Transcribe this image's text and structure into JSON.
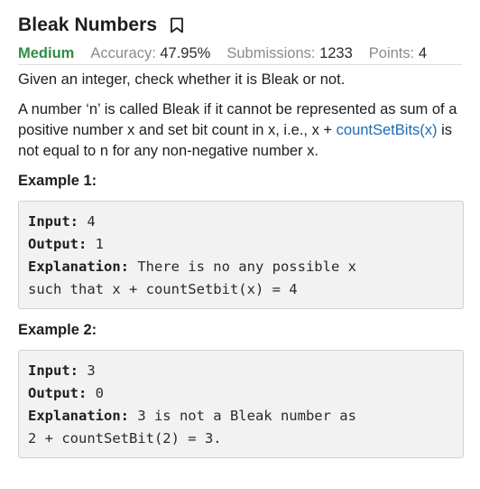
{
  "problem": {
    "title": "Bleak Numbers",
    "bookmark_icon": "bookmark-icon",
    "difficulty": "Medium",
    "difficulty_color": "#2f8d46",
    "accuracy_label": "Accuracy:",
    "accuracy_value": "47.95%",
    "submissions_label": "Submissions:",
    "submissions_value": "1233",
    "points_label": "Points:",
    "points_value": "4"
  },
  "description": {
    "intro": "Given an integer, check whether it is Bleak or not.",
    "definition_before_link": "A number ‘n’ is called Bleak if it cannot be represented as sum of a positive number x and set bit count in x, i.e., x + ",
    "definition_link": "countSetBits(x)",
    "definition_after_link": " is not equal to n for any non-negative number x.",
    "link_color": "#1d6bb5"
  },
  "examples": [
    {
      "title": "Example 1:",
      "input_label": "Input:",
      "input_value": " 4",
      "output_label": "Output:",
      "output_value": " 1",
      "explanation_label": "Explanation:",
      "explanation_value": " There is no any possible x\nsuch that x + countSetbit(x) = 4"
    },
    {
      "title": "Example 2:",
      "input_label": "Input:",
      "input_value": " 3",
      "output_label": "Output:",
      "output_value": " 0",
      "explanation_label": "Explanation:",
      "explanation_value": " 3 is not a Bleak number as\n2 + countSetBit(2) = 3."
    }
  ]
}
